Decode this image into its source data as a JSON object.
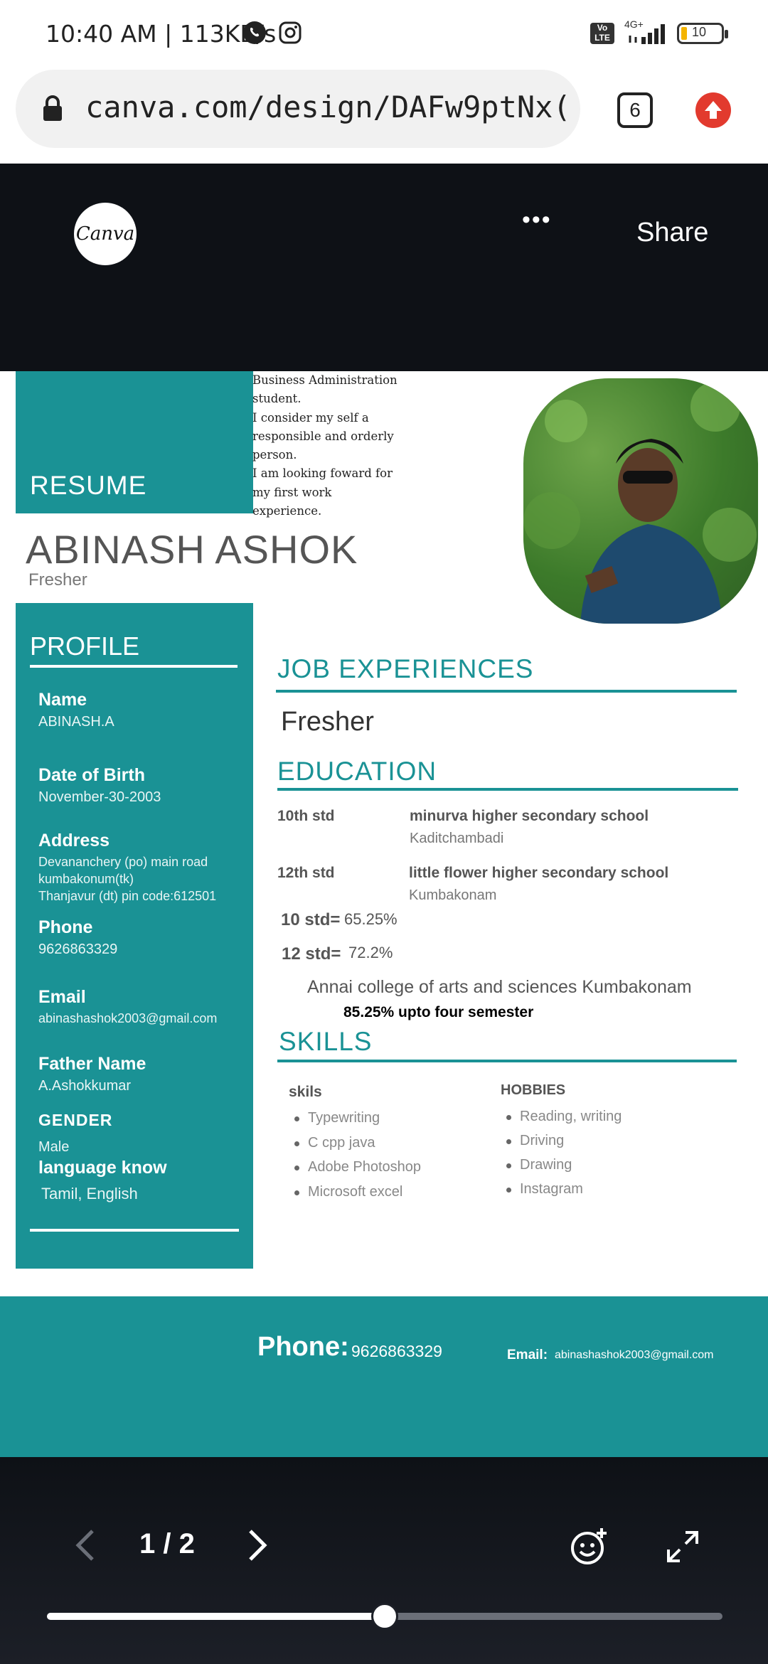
{
  "status": {
    "time_speed": "10:40 AM | 113KB/s",
    "volte": "Vo LTE",
    "network": "4G+",
    "battery": "10"
  },
  "browser": {
    "url": "canva.com/design/DAFw9ptNx(",
    "tab_count": "6"
  },
  "canva": {
    "logo_text": "Canva",
    "share_label": "Share",
    "more_label": "•••"
  },
  "resume": {
    "header_label": "RESUME",
    "intro": [
      "Business Administration",
      "student.",
      "I consider my self a",
      "responsible and orderly",
      "person.",
      "I am looking foward for",
      "my first work",
      "experience."
    ],
    "name": "ABINASH ASHOK",
    "role": "Fresher",
    "profile": {
      "title": "PROFILE",
      "name_label": "Name",
      "name_value": "ABINASH.A",
      "dob_label": "Date of Birth",
      "dob_value": "November-30-2003",
      "address_label": "Address",
      "address_lines": [
        "Devananchery (po) main road",
        "kumbakonum(tk)",
        "Thanjavur (dt) pin code:612501"
      ],
      "phone_label": "Phone",
      "phone_value": "9626863329",
      "email_label": "Email",
      "email_value": "abinashashok2003@gmail.com",
      "father_label": "Father Name",
      "father_value": "A.Ashokkumar",
      "gender_label": "GENDER",
      "gender_value": "Male",
      "lang_label": "language know",
      "lang_value": "Tamil, English"
    },
    "job": {
      "title": "JOB EXPERIENCES",
      "value": "Fresher"
    },
    "education": {
      "title": "EDUCATION",
      "rows": [
        {
          "std": "10th std",
          "school": "minurva higher secondary school",
          "place": "Kaditchambadi"
        },
        {
          "std": "12th std",
          "school": "little flower higher secondary school",
          "place": "Kumbakonam"
        }
      ],
      "score10_label": "10 std=",
      "score10_value": "65.25%",
      "score12_label": "12 std=",
      "score12_value": "72.2%",
      "college": "Annai college of arts and sciences Kumbakonam",
      "college_score": "85.25% upto four semester"
    },
    "skills": {
      "title": "SKILLS",
      "skills_heading": "skils",
      "skills": [
        "Typewriting",
        "C cpp java",
        "Adobe Photoshop",
        "Microsoft excel"
      ],
      "hobbies_heading": "HOBBIES",
      "hobbies": [
        "Reading, writing",
        "Driving",
        "Drawing",
        "Instagram"
      ]
    },
    "footer": {
      "phone_label": "Phone:",
      "phone_value": "9626863329",
      "email_label": "Email:",
      "email_value": "abinashashok2003@gmail.com"
    }
  },
  "pager": {
    "page_indicator": "1 / 2",
    "progress": 0.5
  },
  "colors": {
    "teal": "#1a9295",
    "dark": "#0e1116",
    "upload_red": "#e23a2e"
  }
}
